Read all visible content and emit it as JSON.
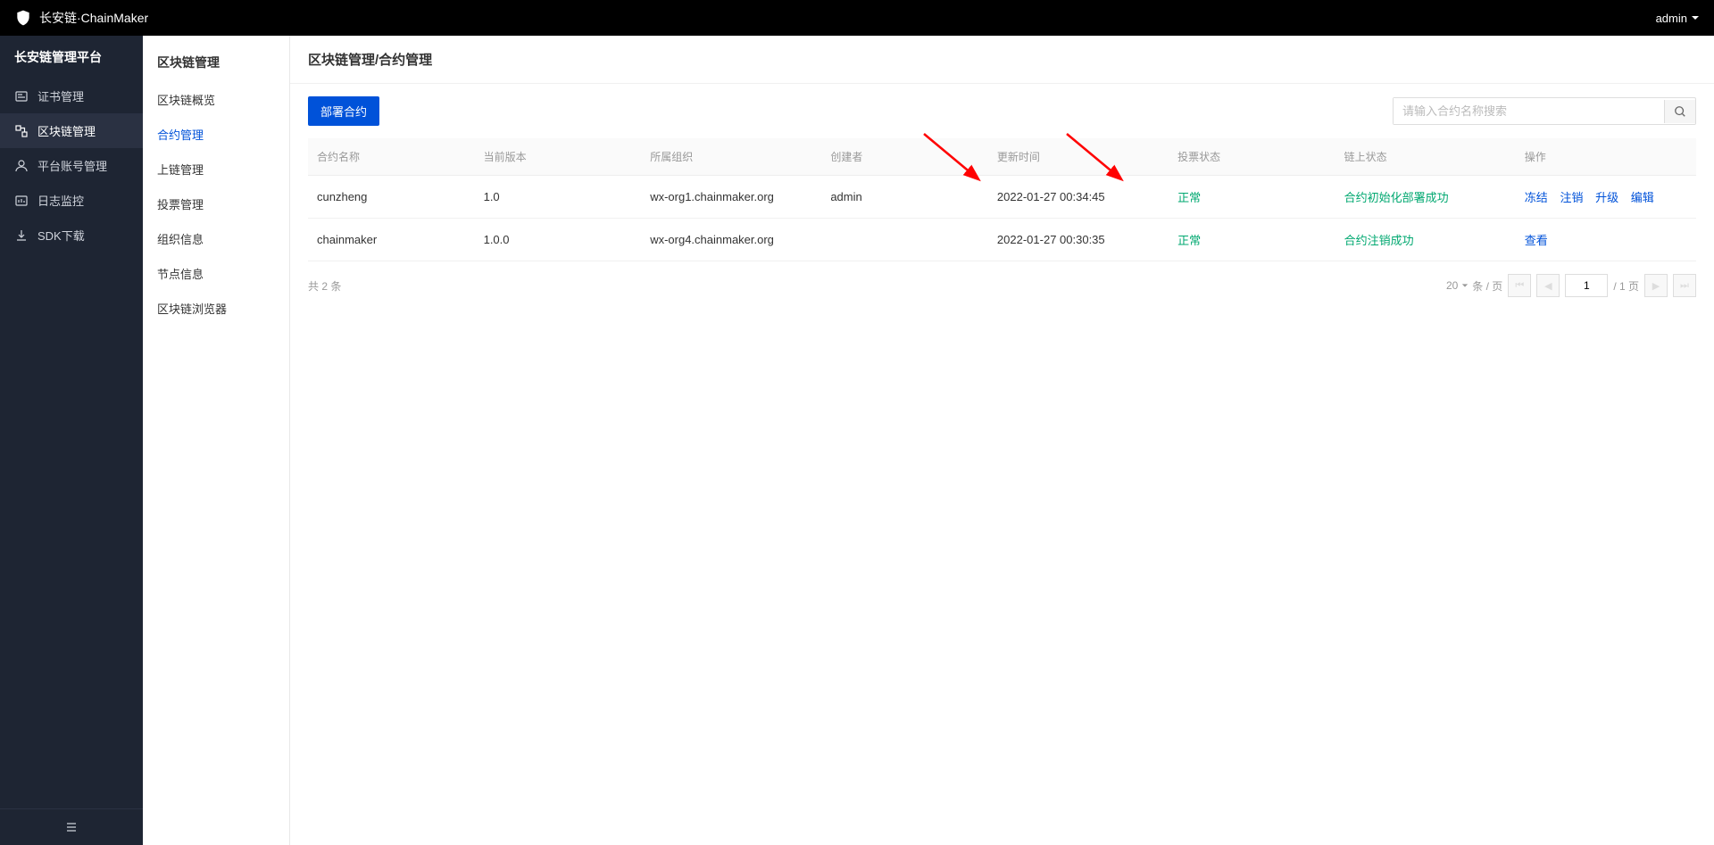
{
  "header": {
    "brand": "长安链·ChainMaker",
    "user": "admin"
  },
  "sidebar": {
    "title": "长安链管理平台",
    "items": [
      {
        "label": "证书管理",
        "icon": "cert"
      },
      {
        "label": "区块链管理",
        "icon": "chain",
        "active": true
      },
      {
        "label": "平台账号管理",
        "icon": "user"
      },
      {
        "label": "日志监控",
        "icon": "log"
      },
      {
        "label": "SDK下载",
        "icon": "download"
      }
    ]
  },
  "subMenu": {
    "title": "区块链管理",
    "items": [
      {
        "label": "区块链概览"
      },
      {
        "label": "合约管理",
        "active": true
      },
      {
        "label": "上链管理"
      },
      {
        "label": "投票管理"
      },
      {
        "label": "组织信息"
      },
      {
        "label": "节点信息"
      },
      {
        "label": "区块链浏览器"
      }
    ]
  },
  "breadcrumb": "区块链管理/合约管理",
  "toolbar": {
    "deployBtn": "部署合约",
    "searchPlaceholder": "请输入合约名称搜索"
  },
  "table": {
    "columns": [
      "合约名称",
      "当前版本",
      "所属组织",
      "创建者",
      "更新时间",
      "投票状态",
      "链上状态",
      "操作"
    ],
    "rows": [
      {
        "name": "cunzheng",
        "version": "1.0",
        "org": "wx-org1.chainmaker.org",
        "creator": "admin",
        "updateTime": "2022-01-27 00:34:45",
        "voteStatus": "正常",
        "chainStatus": "合约初始化部署成功",
        "actions": [
          "冻结",
          "注销",
          "升级",
          "编辑"
        ]
      },
      {
        "name": "chainmaker",
        "version": "1.0.0",
        "org": "wx-org4.chainmaker.org",
        "creator": "",
        "updateTime": "2022-01-27 00:30:35",
        "voteStatus": "正常",
        "chainStatus": "合约注销成功",
        "actions": [
          "查看"
        ]
      }
    ]
  },
  "pagination": {
    "totalText": "共 2 条",
    "pageSize": "20",
    "pageSizeSuffix": "条 / 页",
    "currentPage": "1",
    "pageLabel": "/ 1 页"
  }
}
